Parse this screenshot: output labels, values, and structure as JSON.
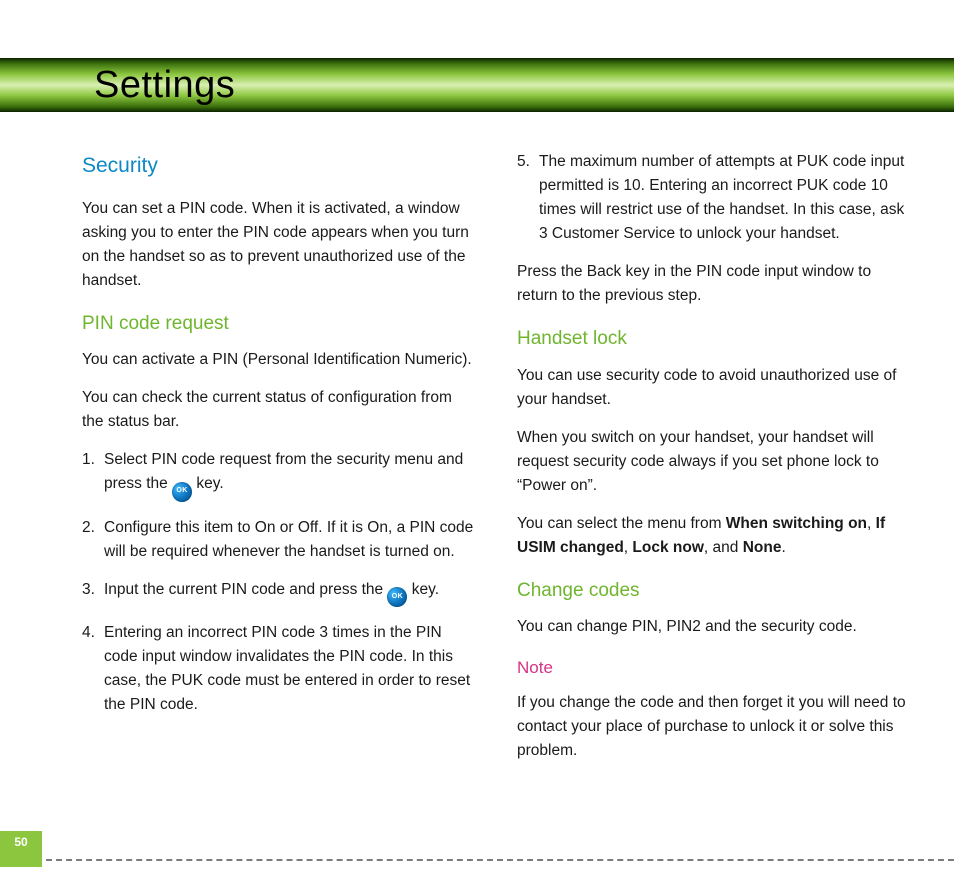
{
  "page_title": "Settings",
  "page_number": "50",
  "ok_label": "OK",
  "left": {
    "security_h": "Security",
    "security_p": "You can set a PIN code. When it is activated, a window asking you to enter the PIN code appears when you turn on the handset so as to prevent unauthorized use of the handset.",
    "pin_h": "PIN code request",
    "pin_p1": "You can activate a PIN (Personal Identification Numeric).",
    "pin_p2": "You can check the current status of configuration from the status bar.",
    "steps": {
      "s1a": "Select PIN code request from the security menu and press the ",
      "s1b": " key.",
      "s2": "Configure this item to On or Off. If it is On, a PIN code will be required whenever the handset is turned on.",
      "s3a": "Input the current PIN code and press the ",
      "s3b": " key.",
      "s4": "Entering an incorrect PIN code 3 times in the PIN code input window invalidates the PIN code. In this case, the PUK code must be entered in order to reset the PIN code."
    }
  },
  "right": {
    "step5": "The maximum number of attempts at PUK code input permitted is 10. Entering an incorrect PUK code 10 times will restrict use of the handset. In this case, ask 3 Customer Service to unlock your handset.",
    "back_p": "Press the Back key in the PIN code input window to return to the previous step.",
    "handset_h": "Handset lock",
    "handset_p1": "You can use security code to avoid unauthorized use of your handset.",
    "handset_p2": "When you switch on your handset, your handset will request security code always if you set phone lock to “Power on”.",
    "handset_p3_a": "You can select the menu from ",
    "handset_p3_b1": "When switching on",
    "handset_p3_c1": ", ",
    "handset_p3_b2": "If USIM changed",
    "handset_p3_c2": ", ",
    "handset_p3_b3": "Lock now",
    "handset_p3_c3": ", and ",
    "handset_p3_b4": "None",
    "handset_p3_c4": ".",
    "change_h": "Change codes",
    "change_p": "You can change PIN, PIN2 and the security code.",
    "note_h": "Note",
    "note_p": "If you change the code and then forget it you will need  to contact your place of purchase to unlock it or solve this problem."
  }
}
